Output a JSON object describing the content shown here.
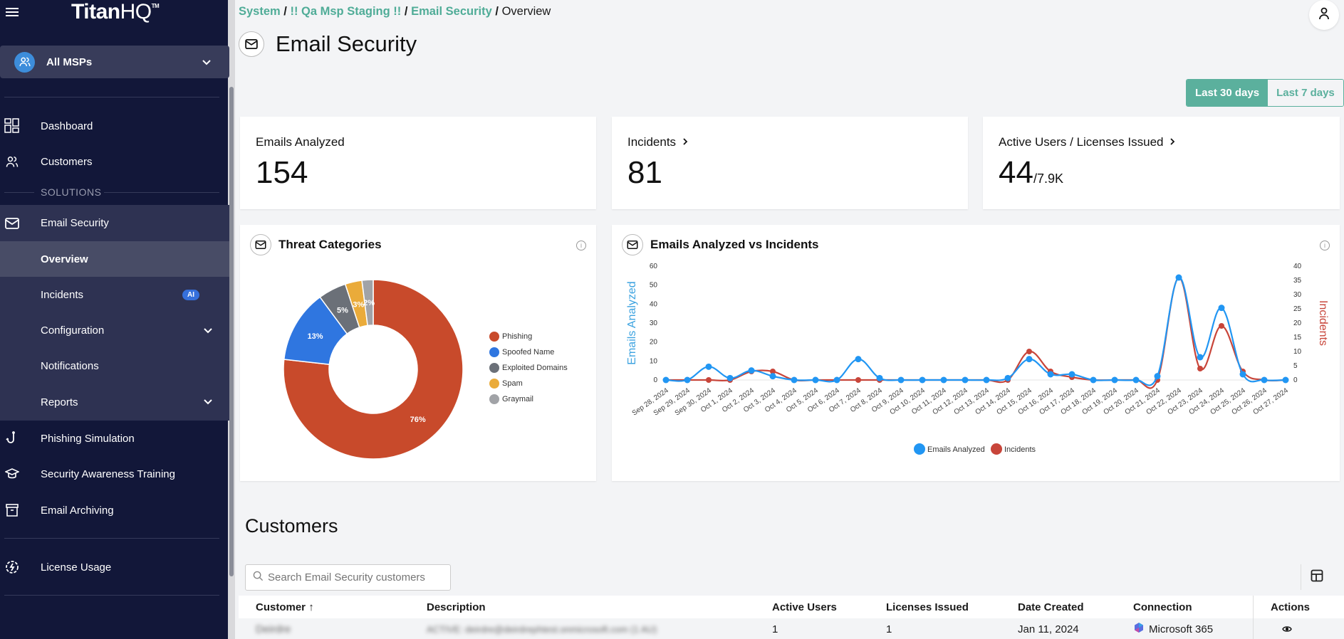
{
  "app": {
    "logo_bold": "Titan",
    "logo_light": "HQ",
    "logo_tm": "TM"
  },
  "sidebar": {
    "msp_selector": "All MSPs",
    "items": [
      {
        "label": "Dashboard",
        "icon": "dashboard-icon"
      },
      {
        "label": "Customers",
        "icon": "users-icon"
      }
    ],
    "section_label": "SOLUTIONS",
    "email_security": {
      "label": "Email Security",
      "icon": "mail-icon"
    },
    "sub_items": [
      {
        "label": "Overview",
        "active": true
      },
      {
        "label": "Incidents",
        "badge": "AI"
      },
      {
        "label": "Configuration",
        "expandable": true
      },
      {
        "label": "Notifications"
      },
      {
        "label": "Reports",
        "expandable": true
      }
    ],
    "more_items": [
      {
        "label": "Phishing Simulation",
        "icon": "hook-icon"
      },
      {
        "label": "Security Awareness Training",
        "icon": "graduation-cap-icon"
      },
      {
        "label": "Email Archiving",
        "icon": "archive-icon"
      }
    ],
    "license_usage": {
      "label": "License Usage",
      "icon": "license-usage-icon"
    }
  },
  "breadcrumb": [
    {
      "label": "System",
      "link": true
    },
    {
      "label": "!! Qa Msp Staging !!",
      "link": true
    },
    {
      "label": "Email Security",
      "link": true
    },
    {
      "label": "Overview",
      "link": false
    }
  ],
  "page_title": "Email Security",
  "range": {
    "options": [
      "Last 30 days",
      "Last 7 days"
    ],
    "selected": "Last 30 days"
  },
  "stats": {
    "emails_analyzed": {
      "label": "Emails Analyzed",
      "value": "154"
    },
    "incidents": {
      "label": "Incidents",
      "value": "81"
    },
    "active_users": {
      "label": "Active Users / Licenses Issued",
      "value": "44",
      "sub": "/7.9K"
    }
  },
  "colors": {
    "accent": "#5bb09d",
    "sidebar_bg": "#121739",
    "phishing": "#c84a2b",
    "spoofed": "#2f76e0",
    "exploited": "#6b7078",
    "spam": "#eaab3a",
    "graymail": "#a1a3a7",
    "emails_series": "#2196f3",
    "incidents_series": "#c8453a"
  },
  "chart_data": [
    {
      "type": "pie",
      "title": "Threat Categories",
      "donut": true,
      "categories": [
        "Phishing",
        "Spoofed Name",
        "Exploited Domains",
        "Spam",
        "Graymail"
      ],
      "values": [
        76,
        13,
        5,
        3,
        2
      ],
      "labels": [
        "76%",
        "13%",
        "5%",
        "3%",
        "2%"
      ],
      "legend": "right"
    },
    {
      "type": "line",
      "title": "Emails Analyzed vs Incidents",
      "x": [
        "Sep 28, 2024",
        "Sep 29, 2024",
        "Sep 30, 2024",
        "Oct 1, 2024",
        "Oct 2, 2024",
        "Oct 3, 2024",
        "Oct 4, 2024",
        "Oct 5, 2024",
        "Oct 6, 2024",
        "Oct 7, 2024",
        "Oct 8, 2024",
        "Oct 9, 2024",
        "Oct 10, 2024",
        "Oct 11, 2024",
        "Oct 12, 2024",
        "Oct 13, 2024",
        "Oct 14, 2024",
        "Oct 15, 2024",
        "Oct 16, 2024",
        "Oct 17, 2024",
        "Oct 18, 2024",
        "Oct 19, 2024",
        "Oct 20, 2024",
        "Oct 21, 2024",
        "Oct 22, 2024",
        "Oct 23, 2024",
        "Oct 24, 2024",
        "Oct 25, 2024",
        "Oct 26, 2024",
        "Oct 27, 2024"
      ],
      "series": [
        {
          "name": "Emails Analyzed",
          "axis": "left",
          "values": [
            0,
            0,
            7,
            1,
            5,
            2,
            0,
            0,
            0,
            11,
            1,
            0,
            0,
            0,
            0,
            0,
            1,
            11,
            3,
            3,
            0,
            0,
            0,
            2,
            54,
            12,
            38,
            3,
            0,
            0
          ]
        },
        {
          "name": "Incidents",
          "axis": "right",
          "values": [
            0,
            0,
            0,
            0,
            3,
            3,
            0,
            0,
            0,
            0,
            0,
            0,
            0,
            0,
            0,
            0,
            0,
            10,
            3,
            1,
            0,
            0,
            0,
            0,
            36,
            4,
            19,
            3,
            0,
            0
          ]
        }
      ],
      "ylabel": "Emails Analyzed",
      "y2label": "Incidents",
      "ylim": [
        0,
        60
      ],
      "y2lim": [
        0,
        40
      ],
      "yticks": [
        0,
        10,
        20,
        30,
        40,
        50,
        60
      ],
      "y2ticks": [
        0,
        5,
        10,
        15,
        20,
        25,
        30,
        35,
        40
      ],
      "legend": "bottom"
    }
  ],
  "customers": {
    "title": "Customers",
    "search_placeholder": "Search Email Security customers",
    "columns": [
      "Customer",
      "Description",
      "Active Users",
      "Licenses Issued",
      "Date Created",
      "Connection",
      "Actions"
    ],
    "sort_indicator": "↑",
    "rows": [
      {
        "customer": "Deirdre",
        "description": "ACTIVE: deirdre@deirdrephtest.onmicrosoft.com (1 AU)",
        "active_users": "1",
        "licenses_issued": "1",
        "date_created": "Jan 11, 2024",
        "connection": "Microsoft 365"
      }
    ]
  }
}
